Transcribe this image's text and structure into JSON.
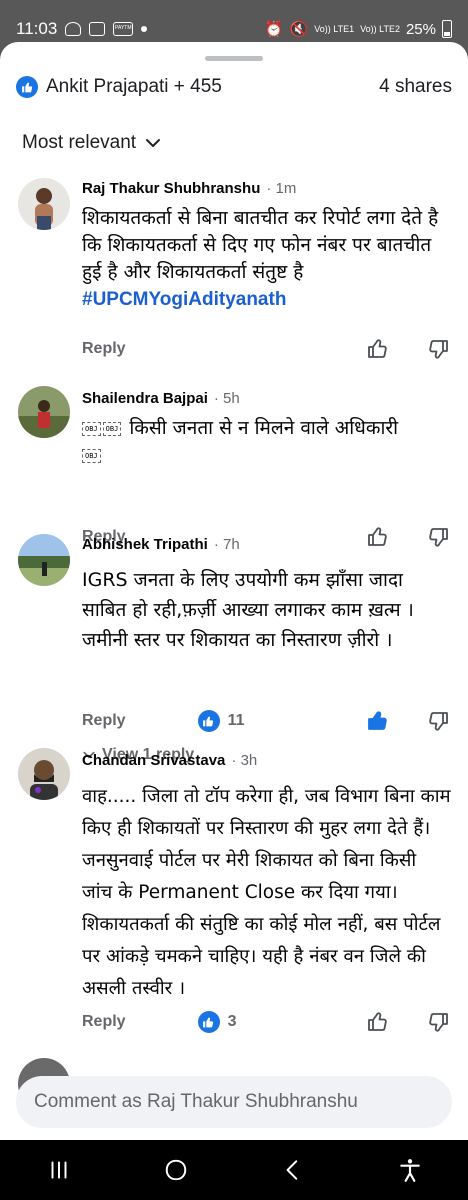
{
  "status_bar": {
    "time": "11:03",
    "battery_percent": "25%",
    "lte1": "Vo)) LTE1",
    "lte2": "Vo)) LTE2",
    "app_badge": "PAYTM"
  },
  "reactions": {
    "names": "Ankit Prajapati + 455",
    "shares": "4 shares"
  },
  "sort": {
    "label": "Most relevant"
  },
  "comments": [
    {
      "author": "Raj Thakur Shubhranshu",
      "time": "· 1m",
      "text": "शिकायतकर्ता से बिना बातचीत कर रिपोर्ट लगा देते है कि शिकायतकर्ता से दिए गए फोन नंबर पर बातचीत हुई है और शिकायतकर्ता संतुष्ट है",
      "hashtag": "#UPCMYogiAdityanath",
      "reply_label": "Reply"
    },
    {
      "author": "Shailendra Bajpai",
      "time": "· 5h",
      "obj_glyph": "OBJ",
      "text": "किसी जनता से न मिलने वाले अधिकारी",
      "reply_label": "Reply"
    },
    {
      "author": "Abhishek Tripathi",
      "time": "· 7h",
      "text": "IGRS जनता के लिए उपयोगी कम झाँसा जादा साबित हो रही,फ़र्ज़ी आख्या लगाकर काम ख़त्म । जमीनी स्तर पर शिकायत का निस्तारण ज़ीरो ।",
      "reply_label": "Reply",
      "like_count": "11",
      "view_replies": "View 1 reply"
    },
    {
      "author": "Chandan Srivastava",
      "time": "· 3h",
      "text": "वाह..... जिला तो टॉप करेगा ही, जब विभाग बिना काम किए ही शिकायतों पर निस्तारण की मुहर लगा देते हैं। जनसुनवाई पोर्टल पर मेरी शिकायत को बिना किसी जांच के Permanent Close कर दिया गया। शिकायतकर्ता की संतुष्टि का कोई मोल नहीं, बस पोर्टल पर आंकड़े चमकने चाहिए। यही है नंबर वन जिले की असली तस्वीर ।",
      "reply_label": "Reply",
      "like_count": "3"
    }
  ],
  "composer": {
    "placeholder": "Comment as Raj Thakur Shubhranshu"
  },
  "colors": {
    "accent": "#1b74e4",
    "hashtag": "#1b5fd1",
    "meta": "#65676b",
    "scrim": "#585858"
  }
}
